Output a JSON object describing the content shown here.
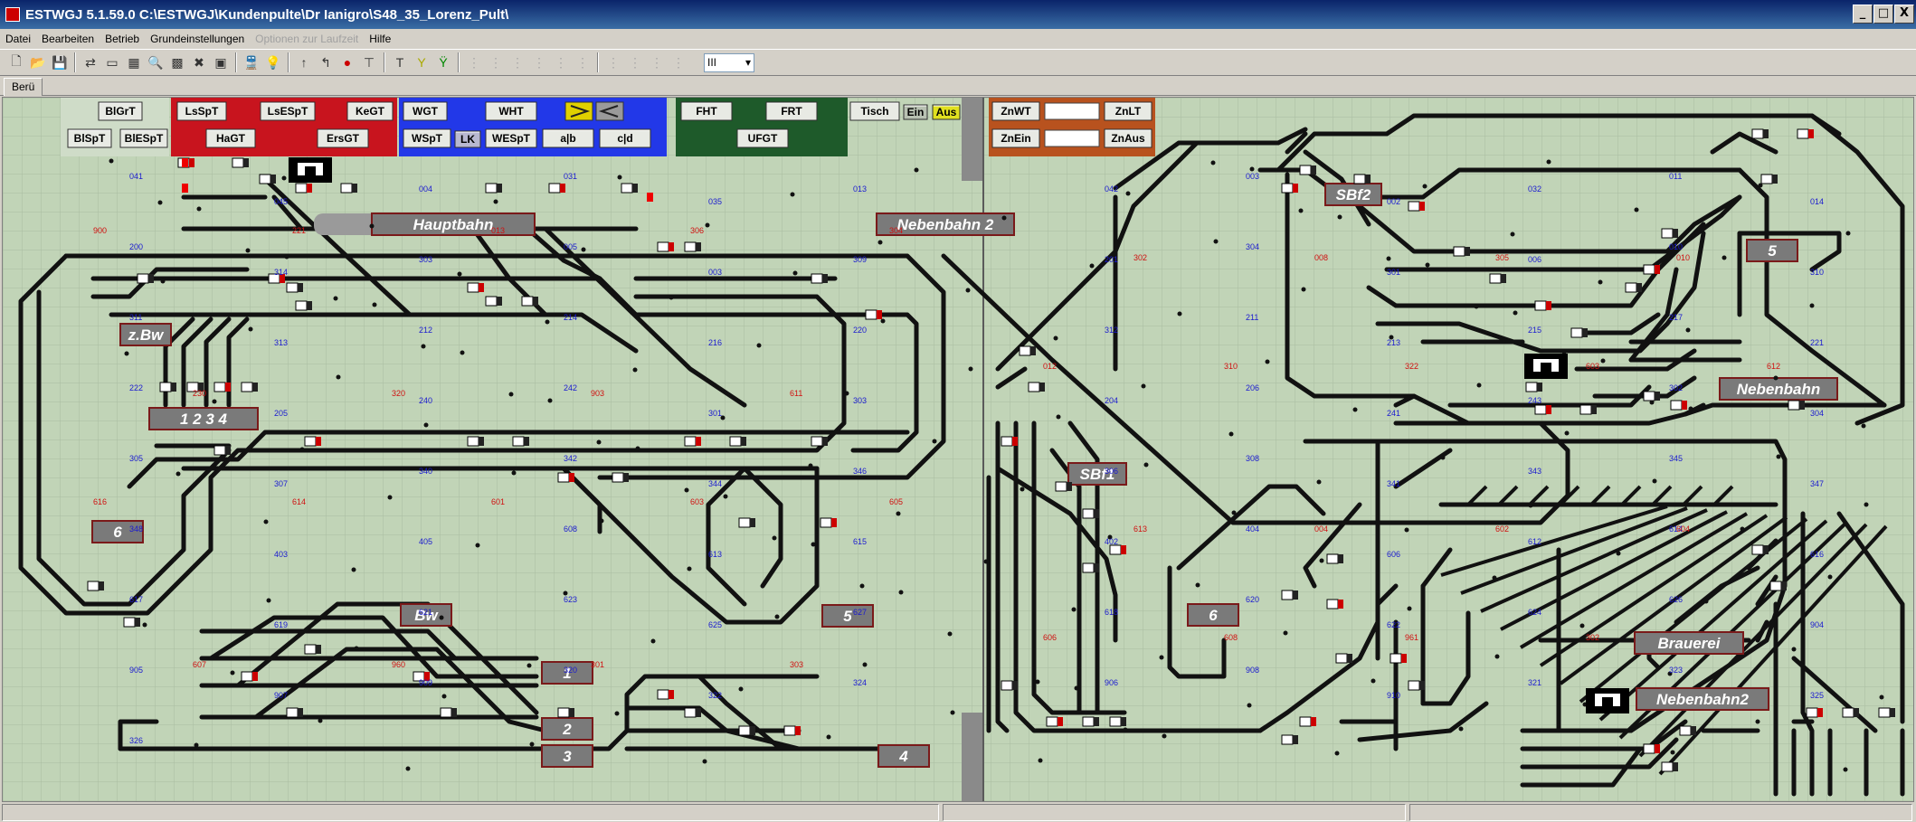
{
  "window": {
    "title": "ESTWGJ 5.1.59.0 C:\\ESTWGJ\\Kundenpulte\\Dr Ianigro\\S48_35_Lorenz_Pult\\",
    "minimize": "_",
    "maximize": "□",
    "close": "X"
  },
  "menu": [
    {
      "label": "Datei",
      "enabled": true
    },
    {
      "label": "Bearbeiten",
      "enabled": true
    },
    {
      "label": "Betrieb",
      "enabled": true
    },
    {
      "label": "Grundeinstellungen",
      "enabled": true
    },
    {
      "label": "Optionen zur Laufzeit",
      "enabled": false
    },
    {
      "label": "Hilfe",
      "enabled": true
    }
  ],
  "toolbar": {
    "icons": [
      "new-file-icon",
      "open-folder-icon",
      "save-icon",
      "separator",
      "route-icon",
      "track-icon",
      "panel-icon",
      "magnifier-icon",
      "grid-icon",
      "delete-icon",
      "layout-icon",
      "separator",
      "train-icon",
      "bulb-icon",
      "separator",
      "signal-up-icon",
      "signal-turn-icon",
      "signal-red-icon",
      "signal-stop-icon",
      "separator",
      "signal-t-icon",
      "signal-y-icon",
      "signal-g-icon",
      "separator",
      "grey-1-icon",
      "grey-2-icon",
      "grey-3-icon",
      "grey-4-icon",
      "grey-5-icon",
      "grey-6-icon",
      "separator",
      "grey-7-icon",
      "grey-8-icon",
      "grey-9-icon",
      "grey-10-icon"
    ],
    "zoom_value": "III"
  },
  "tab": {
    "label": "Berü"
  },
  "colors": {
    "panel_bg": "#c1d4b7",
    "grid": "#a9bca0",
    "track": "#111111",
    "red_block": "#c8141e",
    "blue_block": "#2238e8",
    "green_block": "#1e5a2a",
    "label_box": "#7a7a7a",
    "label_border": "#7a1a1a"
  },
  "control_buttons": {
    "grey": [
      {
        "label": "BlGrT"
      },
      {
        "label": "BlSpT"
      },
      {
        "label": "BlESpT"
      }
    ],
    "red": [
      {
        "label": "LsSpT"
      },
      {
        "label": "LsESpT"
      },
      {
        "label": "KeGT"
      },
      {
        "label": "HaGT"
      },
      {
        "label": "ErsGT"
      }
    ],
    "blue": [
      {
        "label": "WGT"
      },
      {
        "label": "WHT"
      },
      {
        "label": "WSpT"
      },
      {
        "label": "LK"
      },
      {
        "label": "WESpT"
      },
      {
        "label": "a|b"
      },
      {
        "label": "c|d"
      }
    ],
    "green": [
      {
        "label": "FHT"
      },
      {
        "label": "FRT"
      },
      {
        "label": "UFGT"
      }
    ],
    "misc": [
      {
        "label": "Tisch"
      },
      {
        "label": "Ein"
      },
      {
        "label": "Aus"
      }
    ],
    "right": [
      {
        "label": "ZnWT"
      },
      {
        "label": "ZnLT"
      },
      {
        "label": "ZnEin"
      },
      {
        "label": "ZnAus"
      }
    ]
  },
  "station_labels": [
    {
      "id": "hauptbahn",
      "text": "Hauptbahn"
    },
    {
      "id": "nebenbahn2-top",
      "text": "Nebenbahn 2"
    },
    {
      "id": "zbw",
      "text": "z.Bw"
    },
    {
      "id": "tracks-1234",
      "text": "1 2 3 4"
    },
    {
      "id": "six-left",
      "text": "6"
    },
    {
      "id": "bw",
      "text": "Bw"
    },
    {
      "id": "five-mid",
      "text": "5"
    },
    {
      "id": "one",
      "text": "1"
    },
    {
      "id": "two",
      "text": "2"
    },
    {
      "id": "three",
      "text": "3"
    },
    {
      "id": "four",
      "text": "4"
    },
    {
      "id": "sbf1",
      "text": "SBf1"
    },
    {
      "id": "six-right",
      "text": "6"
    },
    {
      "id": "sbf2",
      "text": "SBf2"
    },
    {
      "id": "five-right",
      "text": "5"
    },
    {
      "id": "nebenbahn",
      "text": "Nebenbahn"
    },
    {
      "id": "brauerei",
      "text": "Brauerei"
    },
    {
      "id": "nebenbahn2-bottom",
      "text": "Nebenbahn2"
    }
  ],
  "signal_numbers": {
    "blue": [
      "041",
      "042",
      "045",
      "003",
      "004",
      "002",
      "031",
      "032",
      "035",
      "011",
      "013",
      "014",
      "200",
      "201",
      "314",
      "304",
      "303",
      "301",
      "005",
      "006",
      "003",
      "010",
      "309",
      "310",
      "311",
      "312",
      "313",
      "211",
      "212",
      "213",
      "214",
      "215",
      "216",
      "217",
      "220",
      "221",
      "222",
      "204",
      "205",
      "206",
      "240",
      "241",
      "242",
      "243",
      "301",
      "302",
      "303",
      "304",
      "305",
      "306",
      "307",
      "308",
      "340",
      "341",
      "342",
      "343",
      "344",
      "345",
      "346",
      "347",
      "348",
      "402",
      "403",
      "404",
      "405",
      "606",
      "608",
      "612",
      "613",
      "614",
      "615",
      "616",
      "617",
      "618",
      "619",
      "620",
      "621",
      "622",
      "623",
      "624",
      "625",
      "626",
      "627",
      "904",
      "905",
      "906",
      "907",
      "908",
      "909",
      "910",
      "320",
      "321",
      "322",
      "323",
      "324",
      "325",
      "326"
    ],
    "red": [
      "900",
      "302",
      "221",
      "008",
      "013",
      "305",
      "306",
      "010",
      "304",
      "012",
      "230",
      "310",
      "320",
      "322",
      "903",
      "603",
      "611",
      "612",
      "616",
      "613",
      "614",
      "004",
      "601",
      "602",
      "603",
      "604",
      "605",
      "606",
      "607",
      "608",
      "960",
      "961",
      "301",
      "302",
      "303"
    ]
  },
  "statusbar": {
    "left": "",
    "middle": "",
    "right": ""
  }
}
